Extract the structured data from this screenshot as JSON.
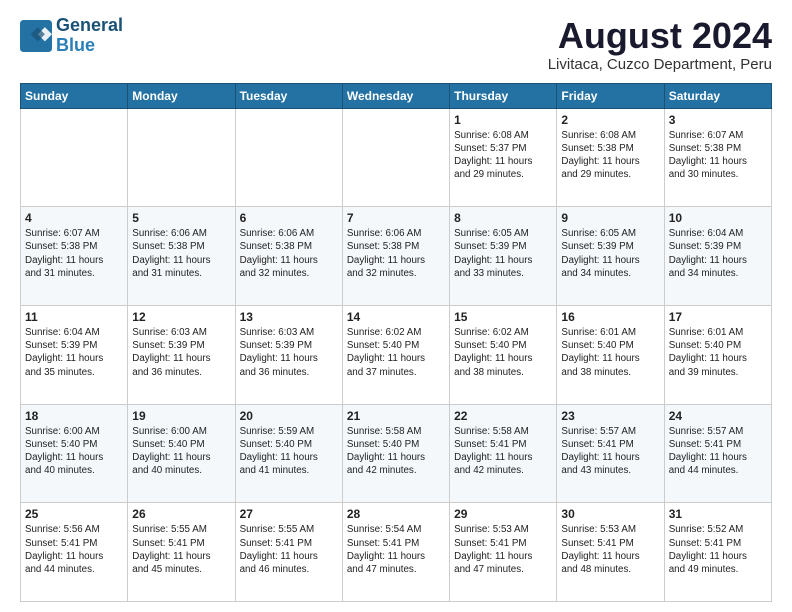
{
  "logo": {
    "line1": "General",
    "line2": "Blue"
  },
  "header": {
    "month_year": "August 2024",
    "location": "Livitaca, Cuzco Department, Peru"
  },
  "days_of_week": [
    "Sunday",
    "Monday",
    "Tuesday",
    "Wednesday",
    "Thursday",
    "Friday",
    "Saturday"
  ],
  "weeks": [
    [
      {
        "day": "",
        "info": ""
      },
      {
        "day": "",
        "info": ""
      },
      {
        "day": "",
        "info": ""
      },
      {
        "day": "",
        "info": ""
      },
      {
        "day": "1",
        "info": "Sunrise: 6:08 AM\nSunset: 5:37 PM\nDaylight: 11 hours\nand 29 minutes."
      },
      {
        "day": "2",
        "info": "Sunrise: 6:08 AM\nSunset: 5:38 PM\nDaylight: 11 hours\nand 29 minutes."
      },
      {
        "day": "3",
        "info": "Sunrise: 6:07 AM\nSunset: 5:38 PM\nDaylight: 11 hours\nand 30 minutes."
      }
    ],
    [
      {
        "day": "4",
        "info": "Sunrise: 6:07 AM\nSunset: 5:38 PM\nDaylight: 11 hours\nand 31 minutes."
      },
      {
        "day": "5",
        "info": "Sunrise: 6:06 AM\nSunset: 5:38 PM\nDaylight: 11 hours\nand 31 minutes."
      },
      {
        "day": "6",
        "info": "Sunrise: 6:06 AM\nSunset: 5:38 PM\nDaylight: 11 hours\nand 32 minutes."
      },
      {
        "day": "7",
        "info": "Sunrise: 6:06 AM\nSunset: 5:38 PM\nDaylight: 11 hours\nand 32 minutes."
      },
      {
        "day": "8",
        "info": "Sunrise: 6:05 AM\nSunset: 5:39 PM\nDaylight: 11 hours\nand 33 minutes."
      },
      {
        "day": "9",
        "info": "Sunrise: 6:05 AM\nSunset: 5:39 PM\nDaylight: 11 hours\nand 34 minutes."
      },
      {
        "day": "10",
        "info": "Sunrise: 6:04 AM\nSunset: 5:39 PM\nDaylight: 11 hours\nand 34 minutes."
      }
    ],
    [
      {
        "day": "11",
        "info": "Sunrise: 6:04 AM\nSunset: 5:39 PM\nDaylight: 11 hours\nand 35 minutes."
      },
      {
        "day": "12",
        "info": "Sunrise: 6:03 AM\nSunset: 5:39 PM\nDaylight: 11 hours\nand 36 minutes."
      },
      {
        "day": "13",
        "info": "Sunrise: 6:03 AM\nSunset: 5:39 PM\nDaylight: 11 hours\nand 36 minutes."
      },
      {
        "day": "14",
        "info": "Sunrise: 6:02 AM\nSunset: 5:40 PM\nDaylight: 11 hours\nand 37 minutes."
      },
      {
        "day": "15",
        "info": "Sunrise: 6:02 AM\nSunset: 5:40 PM\nDaylight: 11 hours\nand 38 minutes."
      },
      {
        "day": "16",
        "info": "Sunrise: 6:01 AM\nSunset: 5:40 PM\nDaylight: 11 hours\nand 38 minutes."
      },
      {
        "day": "17",
        "info": "Sunrise: 6:01 AM\nSunset: 5:40 PM\nDaylight: 11 hours\nand 39 minutes."
      }
    ],
    [
      {
        "day": "18",
        "info": "Sunrise: 6:00 AM\nSunset: 5:40 PM\nDaylight: 11 hours\nand 40 minutes."
      },
      {
        "day": "19",
        "info": "Sunrise: 6:00 AM\nSunset: 5:40 PM\nDaylight: 11 hours\nand 40 minutes."
      },
      {
        "day": "20",
        "info": "Sunrise: 5:59 AM\nSunset: 5:40 PM\nDaylight: 11 hours\nand 41 minutes."
      },
      {
        "day": "21",
        "info": "Sunrise: 5:58 AM\nSunset: 5:40 PM\nDaylight: 11 hours\nand 42 minutes."
      },
      {
        "day": "22",
        "info": "Sunrise: 5:58 AM\nSunset: 5:41 PM\nDaylight: 11 hours\nand 42 minutes."
      },
      {
        "day": "23",
        "info": "Sunrise: 5:57 AM\nSunset: 5:41 PM\nDaylight: 11 hours\nand 43 minutes."
      },
      {
        "day": "24",
        "info": "Sunrise: 5:57 AM\nSunset: 5:41 PM\nDaylight: 11 hours\nand 44 minutes."
      }
    ],
    [
      {
        "day": "25",
        "info": "Sunrise: 5:56 AM\nSunset: 5:41 PM\nDaylight: 11 hours\nand 44 minutes."
      },
      {
        "day": "26",
        "info": "Sunrise: 5:55 AM\nSunset: 5:41 PM\nDaylight: 11 hours\nand 45 minutes."
      },
      {
        "day": "27",
        "info": "Sunrise: 5:55 AM\nSunset: 5:41 PM\nDaylight: 11 hours\nand 46 minutes."
      },
      {
        "day": "28",
        "info": "Sunrise: 5:54 AM\nSunset: 5:41 PM\nDaylight: 11 hours\nand 47 minutes."
      },
      {
        "day": "29",
        "info": "Sunrise: 5:53 AM\nSunset: 5:41 PM\nDaylight: 11 hours\nand 47 minutes."
      },
      {
        "day": "30",
        "info": "Sunrise: 5:53 AM\nSunset: 5:41 PM\nDaylight: 11 hours\nand 48 minutes."
      },
      {
        "day": "31",
        "info": "Sunrise: 5:52 AM\nSunset: 5:41 PM\nDaylight: 11 hours\nand 49 minutes."
      }
    ]
  ]
}
